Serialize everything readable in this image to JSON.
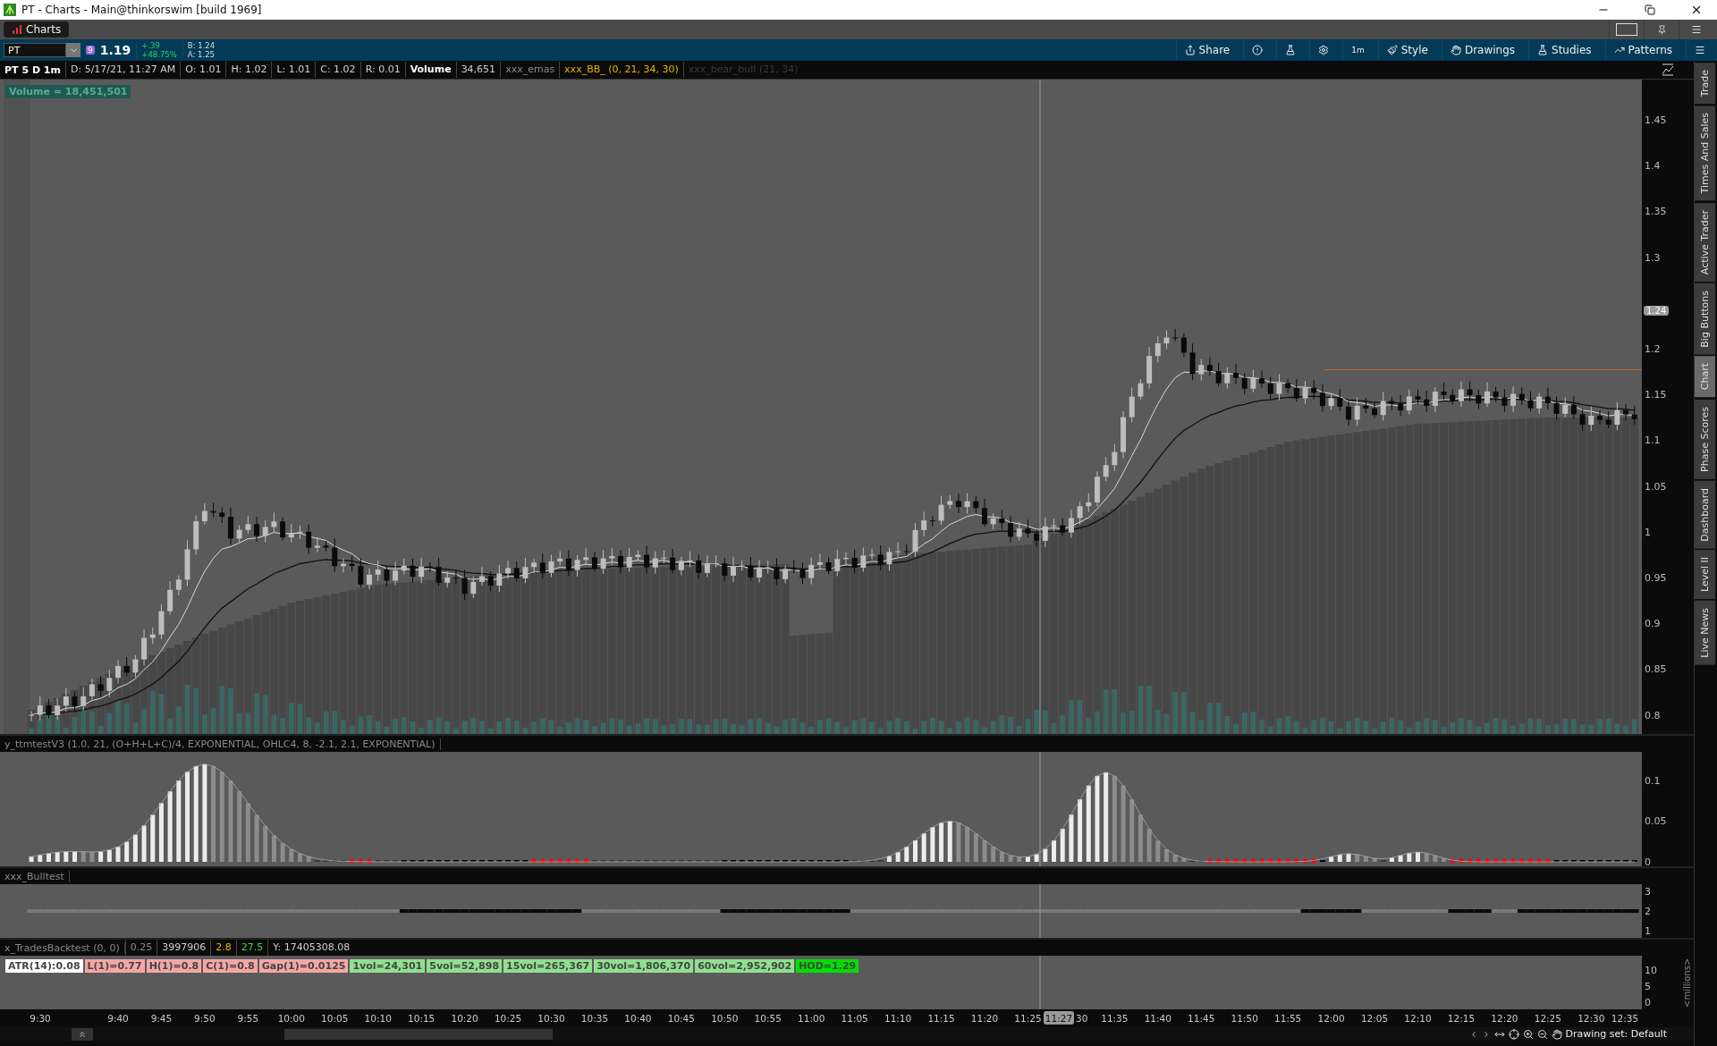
{
  "window": {
    "title": "PT - Charts -  Main@thinkorswim [build 1969]"
  },
  "tabs": [
    {
      "label": "Charts",
      "selected": true
    }
  ],
  "symbol_bar": {
    "symbol": "PT",
    "link_badge": "9",
    "last": "1.19",
    "change": "+.39",
    "change_pct": "+48.75%",
    "bid": "B: 1.24",
    "ask": "A: 1.25"
  },
  "toolbar": [
    {
      "kind": "labeled",
      "label": "Share"
    },
    {
      "kind": "icon"
    },
    {
      "kind": "icon"
    },
    {
      "kind": "icon"
    },
    {
      "kind": "text",
      "label": "1m"
    },
    {
      "kind": "labeled",
      "label": "Style"
    },
    {
      "kind": "labeled",
      "label": "Drawings"
    },
    {
      "kind": "labeled",
      "label": "Studies"
    },
    {
      "kind": "labeled",
      "label": "Patterns"
    },
    {
      "kind": "icon"
    }
  ],
  "header": {
    "title": "PT 5 D 1m",
    "cells": [
      {
        "text": "D: 5/17/21, 11:27 AM",
        "kind": "value"
      },
      {
        "text": "O: 1.01",
        "kind": "value"
      },
      {
        "text": "H: 1.02",
        "kind": "value"
      },
      {
        "text": "L: 1.01",
        "kind": "value"
      },
      {
        "text": "C: 1.02",
        "kind": "value"
      },
      {
        "text": "R: 0.01",
        "kind": "value"
      },
      {
        "text": "Volume",
        "kind": "heading"
      },
      {
        "text": "34,651",
        "kind": "value"
      },
      {
        "text": "xxx_emas",
        "kind": "muted"
      },
      {
        "text": "xxx_BB_ (0, 21, 34, 30)",
        "kind": "highlight"
      },
      {
        "text": "xxx_bear_bull (21, 34)",
        "kind": "hidden"
      }
    ]
  },
  "volume_badge": "Volume = 18,451,501",
  "price_axis": {
    "ticks": [
      "1.45",
      "1.4",
      "1.35",
      "1.3",
      "1.2",
      "1.15",
      "1.1",
      "1.05",
      "1",
      "0.95",
      "0.9",
      "0.85",
      "0.8"
    ],
    "current": "1.24"
  },
  "side_tabs": [
    {
      "label": "Trade",
      "selected": false
    },
    {
      "label": "Times And Sales",
      "selected": false
    },
    {
      "label": "Active Trader",
      "selected": false
    },
    {
      "label": "Big Buttons",
      "selected": false
    },
    {
      "label": "Chart",
      "selected": true
    },
    {
      "label": "Phase Scores",
      "selected": false
    },
    {
      "label": "Dashboard",
      "selected": false
    },
    {
      "label": "Level II",
      "selected": false
    },
    {
      "label": "Live News",
      "selected": false
    }
  ],
  "oscillator": {
    "label": "y_ttmtestV3 (1.0, 21, (O+H+L+C)/4, EXPONENTIAL, OHLC4, 8, -2.1, 2.1, EXPONENTIAL)",
    "ticks": [
      "0.1",
      "0.05",
      "0"
    ]
  },
  "bulltest": {
    "label": "xxx_Bulltest",
    "ticks": [
      "3",
      "2",
      "1"
    ]
  },
  "backtest": {
    "label": "x_TradesBacktest (0, 0)",
    "cells": [
      {
        "text": "0.25",
        "kind": "muted"
      },
      {
        "text": "3997906",
        "kind": "value"
      },
      {
        "text": "2.8",
        "kind": "highlight"
      },
      {
        "text": "27.5",
        "kind": "positive"
      },
      {
        "text": "Y: 17405308.08",
        "kind": "value"
      }
    ],
    "pills": [
      {
        "text": "ATR(14):0.08",
        "color": "#ffffff"
      },
      {
        "text": "L(1)=0.77",
        "color": "#f4a6a6"
      },
      {
        "text": "H(1)=0.8",
        "color": "#f4a6a6"
      },
      {
        "text": "C(1)=0.8",
        "color": "#f4a6a6"
      },
      {
        "text": "Gap(1)=0.0125",
        "color": "#f4a6a6"
      },
      {
        "text": "1vol=24,301",
        "color": "#8fe08f"
      },
      {
        "text": "5vol=52,898",
        "color": "#8fe08f"
      },
      {
        "text": "15vol=265,367",
        "color": "#8fe08f"
      },
      {
        "text": "30vol=1,806,370",
        "color": "#8fe08f"
      },
      {
        "text": "60vol=2,952,902",
        "color": "#8fe08f"
      },
      {
        "text": "HOD=1.29",
        "color": "#00e000"
      }
    ],
    "ticks": [
      "10",
      "5",
      "0"
    ],
    "unit": "<millions>"
  },
  "time_axis": {
    "labels": [
      "9:30",
      "9:40",
      "9:45",
      "9:50",
      "9:55",
      "10:00",
      "10:05",
      "10:10",
      "10:15",
      "10:20",
      "10:25",
      "10:30",
      "10:35",
      "10:40",
      "10:45",
      "10:50",
      "10:55",
      "11:00",
      "11:05",
      "11:10",
      "11:15",
      "11:20",
      "11:25",
      "30",
      "11:35",
      "11:40",
      "11:45",
      "11:50",
      "11:55",
      "12:00",
      "12:05",
      "12:10",
      "12:15",
      "12:20",
      "12:25",
      "12:30",
      "12:35"
    ],
    "cursor": "11:27"
  },
  "status_bar": {
    "drawing_set": "Drawing set: Default"
  }
}
